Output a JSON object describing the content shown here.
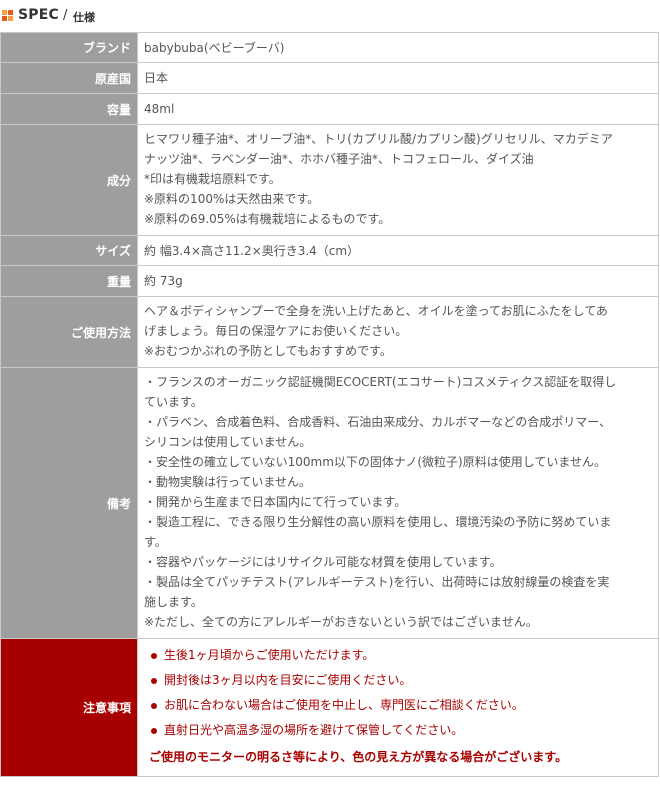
{
  "heading": {
    "en": "SPEC",
    "sep": "/",
    "ja": "仕様"
  },
  "rows": {
    "brand": {
      "label": "ブランド",
      "value": "babybuba(ベビーブーバ)"
    },
    "origin": {
      "label": "原産国",
      "value": "日本"
    },
    "volume": {
      "label": "容量",
      "value": "48ml"
    },
    "ingredients": {
      "label": "成分",
      "lines": [
        "ヒマワリ種子油*、オリーブ油*、トリ(カプリル酸/カプリン酸)グリセリル、マカデミア",
        "ナッツ油*、ラベンダー油*、ホホバ種子油*、トコフェロール、ダイズ油",
        "*印は有機栽培原料です。",
        "※原料の100%は天然由来です。",
        "※原料の69.05%は有機栽培によるものです。"
      ]
    },
    "size": {
      "label": "サイズ",
      "value": "約 幅3.4×高さ11.2×奥行き3.4（cm）"
    },
    "weight": {
      "label": "重量",
      "value": "約 73g"
    },
    "usage": {
      "label": "ご使用方法",
      "lines": [
        "ヘア＆ボディシャンプーで全身を洗い上げたあと、オイルを塗ってお肌にふたをしてあ",
        "げましょう。毎日の保湿ケアにお使いください。",
        "※おむつかぶれの予防としてもおすすめです。"
      ]
    },
    "notes": {
      "label": "備考",
      "lines": [
        "・フランスのオーガニック認証機関ECOCERT(エコサート)コスメティクス認証を取得し",
        "ています。",
        "・パラベン、合成着色料、合成香料、石油由来成分、カルボマーなどの合成ポリマー、",
        "シリコンは使用していません。",
        "・安全性の確立していない100mm以下の固体ナノ(微粒子)原料は使用していません。",
        "・動物実験は行っていません。",
        "・開発から生産まで日本国内にて行っています。",
        "・製造工程に、できる限り生分解性の高い原料を使用し、環境汚染の予防に努めていま",
        "す。",
        "・容器やパッケージにはリサイクル可能な材質を使用しています。",
        "・製品は全てパッチテスト(アレルギーテスト)を行い、出荷時には放射線量の検査を実",
        "施します。",
        "※ただし、全ての方にアレルギーがおきないという訳ではございません。"
      ]
    },
    "caution": {
      "label": "注意事項",
      "items": [
        "生後1ヶ月頃からご使用いただけます。",
        "開封後は3ヶ月以内を目安にご使用ください。",
        "お肌に合わない場合はご使用を中止し、専門医にご相談ください。",
        "直射日光や高温多湿の場所を避けて保管してください。"
      ],
      "note": "ご使用のモニターの明るさ等により、色の見え方が異なる場合がございます。"
    }
  },
  "colors": {
    "label_bg": "#9e9e9e",
    "caution_bg": "#a80000",
    "caution_text": "#a80000",
    "border": "#c8c8c8",
    "icon_orange": "#e05a18",
    "icon_light": "#f4a340"
  }
}
